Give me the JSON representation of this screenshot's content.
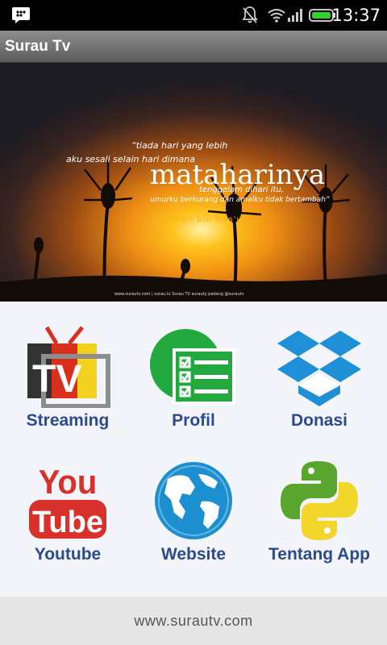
{
  "status_bar": {
    "time": "13:37"
  },
  "app_bar": {
    "title": "Surau Tv"
  },
  "banner": {
    "quote_line1": "“tiada hari yang lebih",
    "quote_line2": "aku sesali selain hari dimana",
    "quote_big": "mataharinya",
    "quote_line3": "tenggelam dihari itu,",
    "quote_line4": "umurku berkurang dan amalku  tidak bertambah”",
    "author": "Abdullah bin Mas'ud",
    "credits": "www.surautv.com | surau.tv   Surau TV   surauty padang   @surautv"
  },
  "menu": [
    {
      "label": "Streaming",
      "icon": "tv-icon"
    },
    {
      "label": "Profil",
      "icon": "profile-list-icon"
    },
    {
      "label": "Donasi",
      "icon": "dropbox-icon"
    },
    {
      "label": "Youtube",
      "icon": "youtube-icon"
    },
    {
      "label": "Website",
      "icon": "globe-icon"
    },
    {
      "label": "Tentang App",
      "icon": "python-icon"
    }
  ],
  "footer": {
    "url": "www.surautv.com"
  },
  "colors": {
    "label": "#2b4a90",
    "grid_bg": "#f4f5fa",
    "footer_bg": "#e6e6e6"
  }
}
